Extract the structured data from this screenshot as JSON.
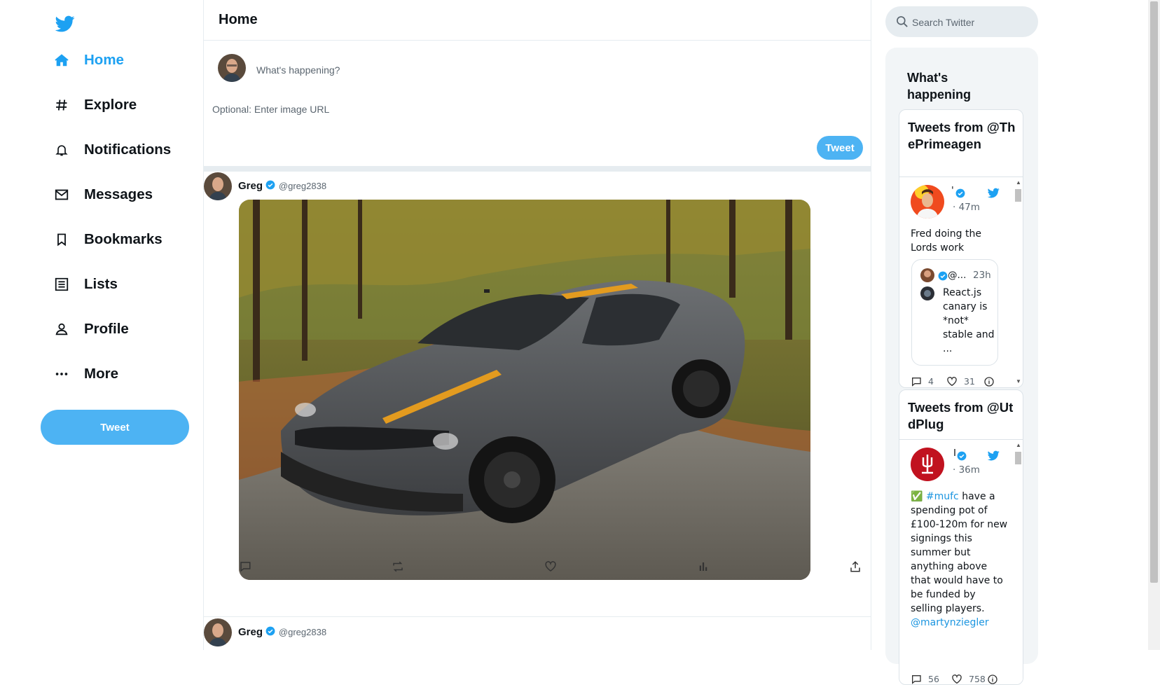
{
  "nav": {
    "items": [
      {
        "label": "Home",
        "icon": "home-icon",
        "active": true
      },
      {
        "label": "Explore",
        "icon": "hashtag-icon"
      },
      {
        "label": "Notifications",
        "icon": "bell-icon"
      },
      {
        "label": "Messages",
        "icon": "mail-icon"
      },
      {
        "label": "Bookmarks",
        "icon": "bookmark-icon"
      },
      {
        "label": "Lists",
        "icon": "list-icon"
      },
      {
        "label": "Profile",
        "icon": "person-icon"
      },
      {
        "label": "More",
        "icon": "more-icon"
      }
    ],
    "tweet_button": "Tweet"
  },
  "main": {
    "title": "Home",
    "compose": {
      "placeholder": "What's happening?",
      "image_placeholder": "Optional: Enter image URL",
      "tweet_button": "Tweet"
    },
    "tweets": [
      {
        "name": "Greg",
        "handle": "@greg2838",
        "verified": true,
        "has_image": true
      },
      {
        "name": "Greg",
        "handle": "@greg2838",
        "verified": true
      }
    ]
  },
  "right": {
    "search_placeholder": "Search Twitter",
    "trends_title": "What's happening",
    "embeds": [
      {
        "title": "Tweets from @ThePrimeagen",
        "tweet": {
          "name": "'",
          "time": "· 47m",
          "text": "Fred doing the Lords work",
          "quote": {
            "handle": "@...",
            "time": "23h",
            "text": "React.js canary is *not* stable and ..."
          },
          "replies": "4",
          "likes": "31"
        }
      },
      {
        "title": "Tweets from @UtdPlug",
        "tweet": {
          "name": "I",
          "time": "· 36m",
          "check": "✅",
          "hashtag": "#mufc",
          "text": " have a spending pot of £100-120m for new signings this summer but anything above that would have to be funded by selling players.",
          "mention": "@martynziegler",
          "replies": "56",
          "likes": "758"
        }
      }
    ]
  },
  "colors": {
    "accent": "#1da1f2",
    "tweet_button": "#4db3f3",
    "border": "#e6ecf0",
    "panel": "#f2f5f7"
  }
}
